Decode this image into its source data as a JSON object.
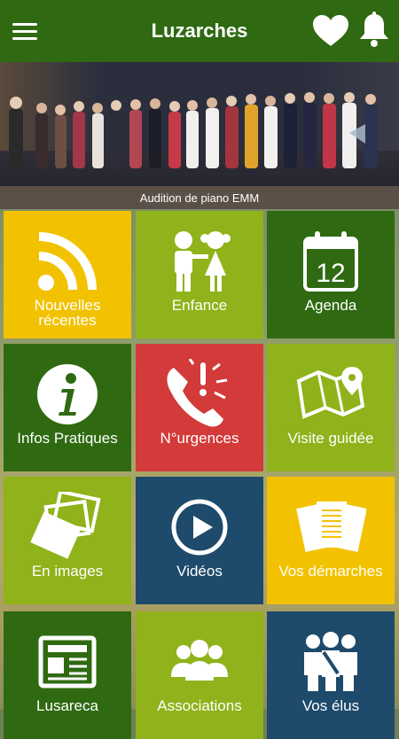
{
  "header": {
    "title": "Luzarches",
    "menu_icon": "hamburger-menu-icon",
    "favorite_icon": "heart-icon",
    "notification_icon": "bell-icon"
  },
  "banner": {
    "caption": "Audition de piano EMM"
  },
  "tiles": [
    {
      "label": "Nouvelles récentes",
      "icon": "rss-icon",
      "color": "#f2c200"
    },
    {
      "label": "Enfance",
      "icon": "children-icon",
      "color": "#90b21a"
    },
    {
      "label": "Agenda",
      "icon": "calendar-icon",
      "color": "#2f6a12",
      "calendar_day": "12"
    },
    {
      "label": "Infos Pratiques",
      "icon": "info-icon",
      "color": "#2f6a12"
    },
    {
      "label": "N°urgences",
      "icon": "phone-alert-icon",
      "color": "#d33a3a"
    },
    {
      "label": "Visite guidée",
      "icon": "map-pin-icon",
      "color": "#90b21a"
    },
    {
      "label": "En images",
      "icon": "photos-icon",
      "color": "#90b21a"
    },
    {
      "label": "Vidéos",
      "icon": "play-icon",
      "color": "#1e4a6b"
    },
    {
      "label": "Vos démarches",
      "icon": "documents-icon",
      "color": "#f2c200"
    },
    {
      "label": "Lusareca",
      "icon": "newspaper-icon",
      "color": "#2f6a12"
    },
    {
      "label": "Associations",
      "icon": "group-icon",
      "color": "#90b21a"
    },
    {
      "label": "Vos élus",
      "icon": "officials-icon",
      "color": "#1e4a6b"
    }
  ]
}
